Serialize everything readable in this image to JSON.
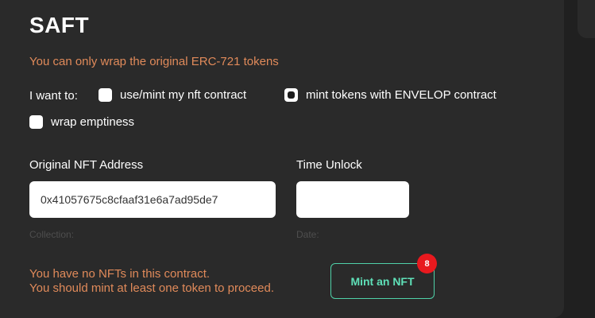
{
  "card": {
    "title": "SAFT",
    "warning": "You can only wrap the original ERC-721 tokens"
  },
  "options": {
    "label": "I want to:",
    "items": [
      {
        "label": "use/mint my nft contract",
        "checked": false
      },
      {
        "label": "mint tokens with ENVELOP contract",
        "checked": true
      },
      {
        "label": "wrap emptiness",
        "checked": false
      }
    ]
  },
  "fields": {
    "nft_address": {
      "label": "Original NFT Address",
      "value": "0x41057675c8cfaaf31e6a7ad95de7",
      "hint": "Collection:"
    },
    "time_unlock": {
      "label": "Time Unlock",
      "value": "",
      "hint": "Date:"
    }
  },
  "mint": {
    "message_line1": "You have no NFTs in  this contract.",
    "message_line2": "You should mint at  least one token to  proceed.",
    "button_label": "Mint an  NFT",
    "badge_count": "8"
  },
  "colors": {
    "accent": "#4fd1a8",
    "warning": "#e08a5a",
    "badge": "#e8191e"
  }
}
